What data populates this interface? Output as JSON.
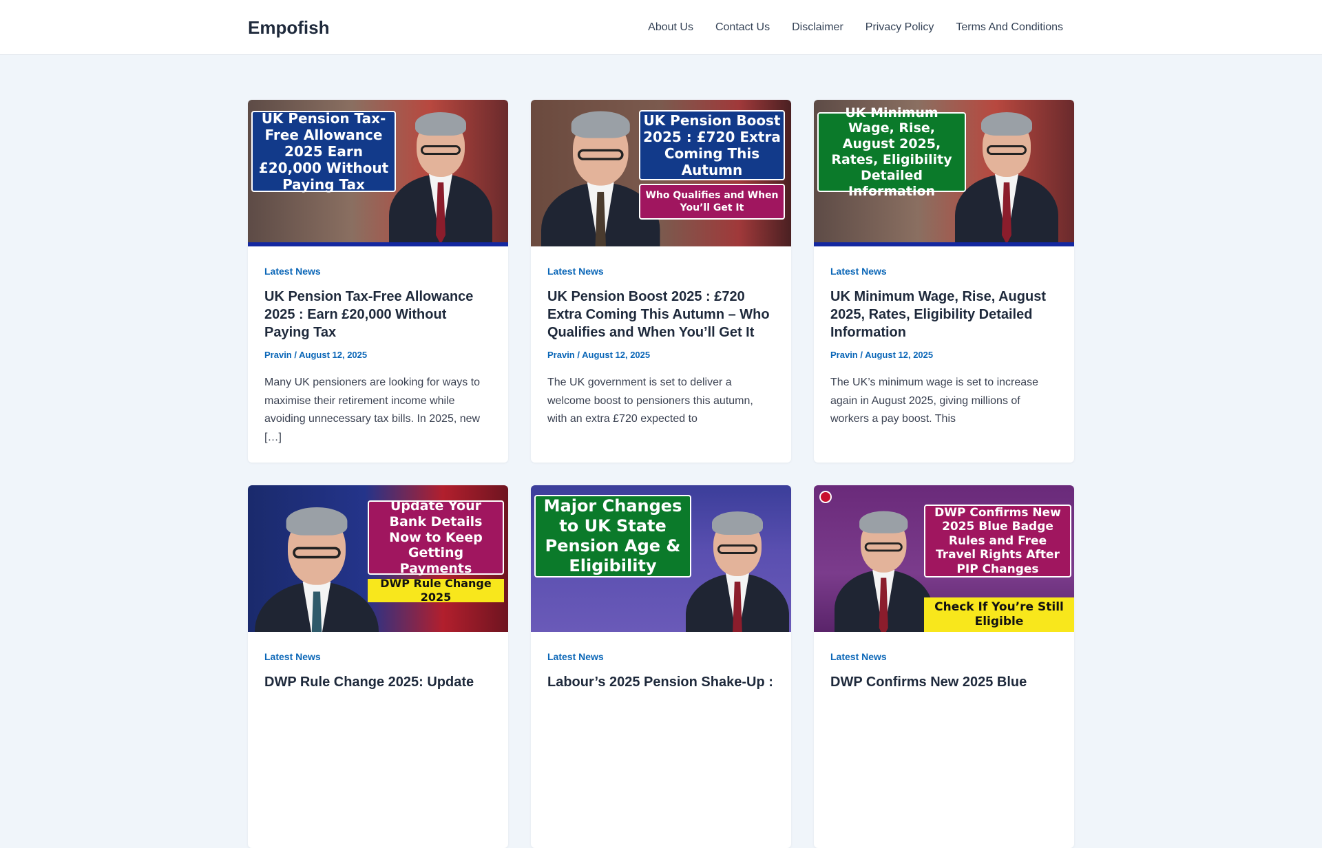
{
  "site": {
    "title": "Empofish"
  },
  "nav": [
    {
      "label": "About Us"
    },
    {
      "label": "Contact Us"
    },
    {
      "label": "Disclaimer"
    },
    {
      "label": "Privacy Policy"
    },
    {
      "label": "Terms And Conditions"
    }
  ],
  "colors": {
    "accent": "#0a66b7",
    "background": "#f0f5fa",
    "banner_blue": "#123a8a",
    "banner_green": "#0b7a2a",
    "banner_magenta": "#a0165f",
    "banner_yellow": "#f8e71c"
  },
  "posts": [
    {
      "category": "Latest News",
      "title": "UK Pension Tax-Free Allowance 2025 : Earn £20,000 Without Paying Tax",
      "author": "Pravin",
      "separator": "/",
      "date": "August 12, 2025",
      "excerpt": "Many UK pensioners are looking for ways to maximise their retirement income while avoiding unnecessary tax bills. In 2025, new […]",
      "image_text": "UK Pension Tax-Free Allowance 2025 Earn £20,000 Without Paying Tax"
    },
    {
      "category": "Latest News",
      "title": "UK Pension Boost 2025 : £720 Extra Coming This Autumn – Who Qualifies and When You’ll Get It",
      "author": "Pravin",
      "separator": "/",
      "date": "August 12, 2025",
      "excerpt": "The UK government is set to deliver a welcome boost to pensioners this autumn, with an extra £720 expected to",
      "image_text": "UK Pension Boost 2025 : £720 Extra Coming This Autumn",
      "image_subtext": "Who Qualifies and When You’ll Get It"
    },
    {
      "category": "Latest News",
      "title": "UK Minimum Wage, Rise, August 2025, Rates, Eligibility Detailed Information",
      "author": "Pravin",
      "separator": "/",
      "date": "August 12, 2025",
      "excerpt": "The UK’s minimum wage is set to increase again in August 2025, giving millions of workers a pay boost. This",
      "image_text": "UK Minimum Wage, Rise, August 2025, Rates, Eligibility Detailed Information"
    },
    {
      "category": "Latest News",
      "title": "DWP Rule Change 2025: Update",
      "image_text": "Update Your Bank Details Now to Keep Getting Payments",
      "image_subtext": "DWP Rule Change 2025"
    },
    {
      "category": "Latest News",
      "title": "Labour’s 2025 Pension Shake-Up :",
      "image_text": "Major Changes to UK State Pension Age & Eligibility"
    },
    {
      "category": "Latest News",
      "title": "DWP Confirms New 2025 Blue",
      "image_text": "DWP Confirms New 2025 Blue Badge Rules and Free Travel Rights After PIP Changes",
      "image_subtext": "Check If You’re Still Eligible"
    }
  ]
}
